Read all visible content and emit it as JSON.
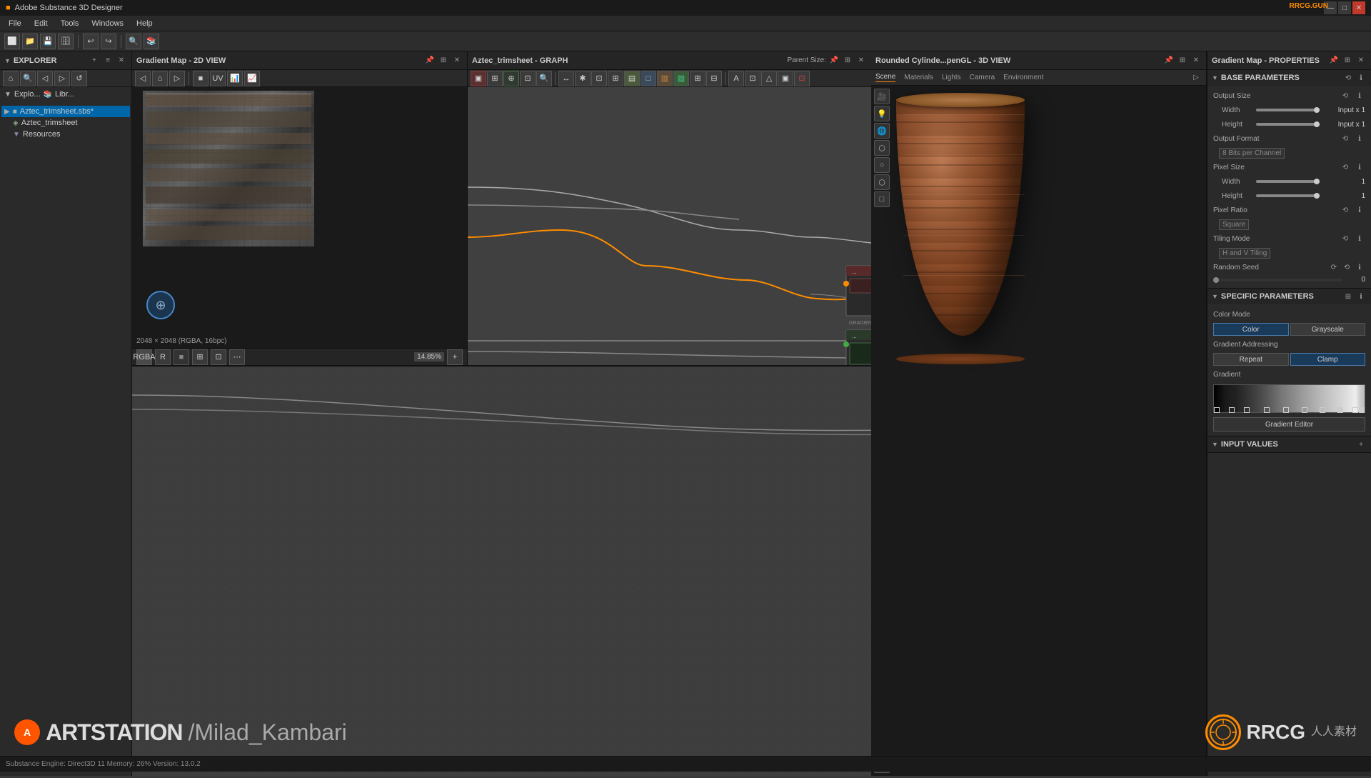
{
  "app": {
    "title": "Adobe Substance 3D Designer",
    "rrcg": "RRCG.GUN"
  },
  "titlebar": {
    "title": "Adobe Substance 3D Designer",
    "minimize": "—",
    "maximize": "□",
    "close": "✕"
  },
  "menubar": {
    "items": [
      "File",
      "Edit",
      "Tools",
      "Windows",
      "Help"
    ]
  },
  "view2d": {
    "title": "Gradient Map - 2D VIEW",
    "info": "2048 × 2048 (RGBA, 16bpc)",
    "zoom": "14.85%"
  },
  "graph": {
    "title": "Aztec_trimsheet - GRAPH"
  },
  "view3d": {
    "title": "Rounded Cylinde...penGL - 3D VIEW",
    "tabs": [
      "Scene",
      "Materials",
      "Lights",
      "Camera",
      "Environment"
    ]
  },
  "properties": {
    "title": "Gradient Map - PROPERTIES",
    "sections": {
      "base": "BASE PARAMETERS",
      "specific": "SPECIFIC PARAMETERS"
    },
    "output_size": {
      "label": "Output Size",
      "width_label": "Width",
      "height_label": "Height",
      "width_value": "Input x 1",
      "height_value": "Input x 1"
    },
    "output_format": {
      "label": "Output Format",
      "value": "8 Bits per Channel"
    },
    "pixel_size": {
      "label": "Pixel Size",
      "width_label": "Width",
      "height_label": "Height",
      "width_value": "1",
      "height_value": "1"
    },
    "pixel_ratio": {
      "label": "Pixel Ratio",
      "value": "Square"
    },
    "tiling_mode": {
      "label": "Tiling Mode",
      "value": "H and V Tiling"
    },
    "random_seed": {
      "label": "Random Seed",
      "value": "0"
    },
    "color_mode": {
      "label": "Color Mode",
      "color_btn": "Color",
      "grayscale_btn": "Grayscale"
    },
    "gradient_addressing": {
      "label": "Gradient Addressing",
      "repeat_btn": "Repeat",
      "clamp_btn": "Clamp"
    },
    "gradient": {
      "label": "Gradient",
      "editor_btn": "Gradient Editor"
    },
    "input_values": {
      "label": "INPUT VALUES"
    }
  },
  "explorer": {
    "title": "EXPLORER",
    "items": [
      {
        "label": "Aztec_trimsheet.sbs*",
        "type": "file",
        "depth": 0
      },
      {
        "label": "Aztec_trimsheet",
        "type": "folder",
        "depth": 1
      },
      {
        "label": "Resources",
        "type": "folder",
        "depth": 1
      }
    ]
  },
  "statusbar": {
    "text": "Substance Engine: Direct3D 11  Memory: 26%     Version: 13.0.2"
  },
  "watermark": {
    "artstation": "ARTSTATION / Milad_Kambari",
    "rrcg": "RRCG"
  },
  "parent_size": "Parent Size:"
}
